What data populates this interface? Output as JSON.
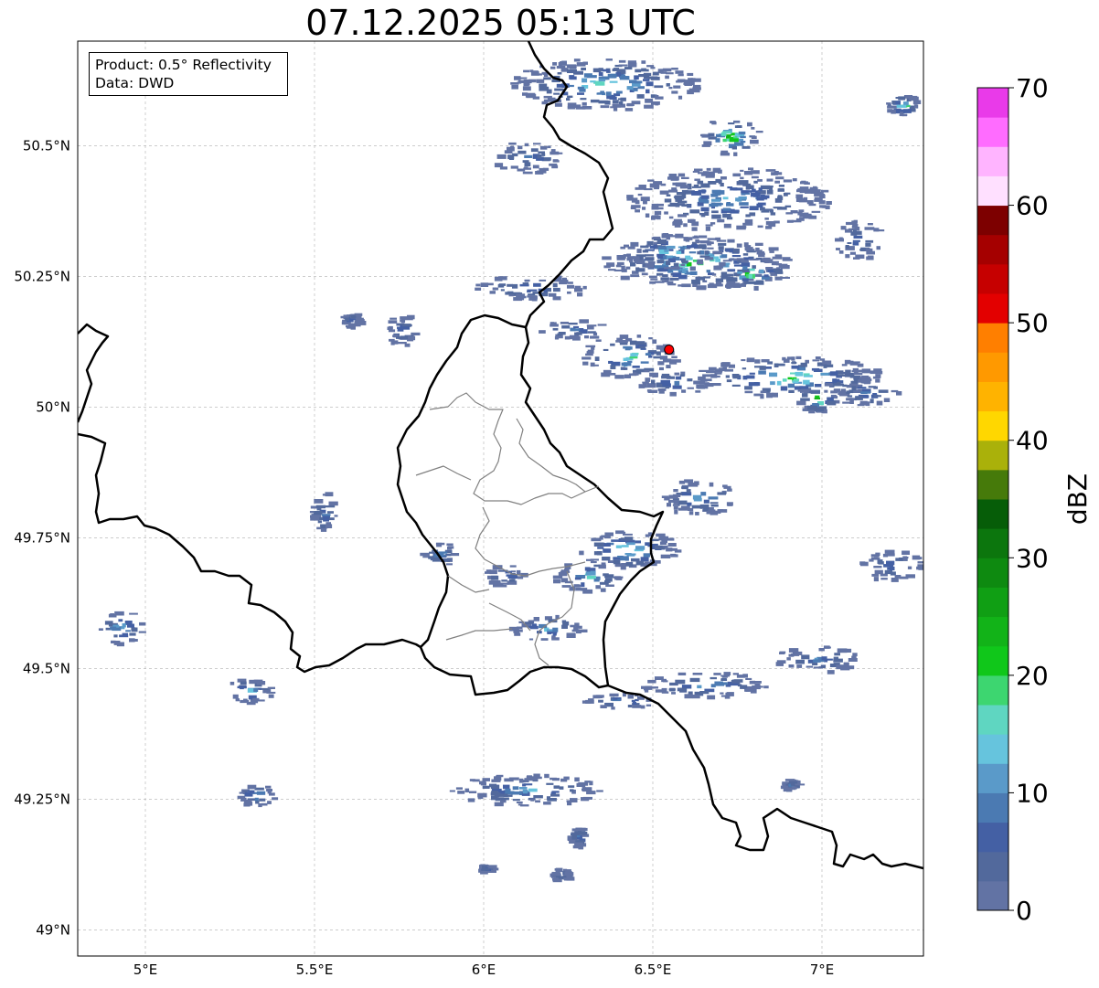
{
  "title": "07.12.2025 05:13 UTC",
  "info": {
    "product": "Product: 0.5° Reflectivity",
    "data": "Data: DWD"
  },
  "map_extent": {
    "lon": [
      4.8,
      7.3
    ],
    "lat": [
      48.95,
      50.7
    ]
  },
  "axes": {
    "lon_ticks": [
      {
        "value": 5.0,
        "label": "5°E"
      },
      {
        "value": 5.5,
        "label": "5.5°E"
      },
      {
        "value": 6.0,
        "label": "6°E"
      },
      {
        "value": 6.5,
        "label": "6.5°E"
      },
      {
        "value": 7.0,
        "label": "7°E"
      }
    ],
    "lat_ticks": [
      {
        "value": 50.5,
        "label": "50.5°N"
      },
      {
        "value": 50.25,
        "label": "50.25°N"
      },
      {
        "value": 50.0,
        "label": "50°N"
      },
      {
        "value": 49.75,
        "label": "49.75°N"
      },
      {
        "value": 49.5,
        "label": "49.5°N"
      },
      {
        "value": 49.25,
        "label": "49.25°N"
      },
      {
        "value": 49.0,
        "label": "49°N"
      }
    ],
    "gridlines": true
  },
  "radar_site": {
    "lon": 6.548,
    "lat": 50.11,
    "color": "#ff0000"
  },
  "colorbar": {
    "label": "dBZ",
    "min": 0,
    "max": 70,
    "step": 2.5,
    "tick_labels": [
      "0",
      "10",
      "20",
      "30",
      "40",
      "50",
      "60",
      "70"
    ],
    "colors": [
      "#6273a4",
      "#52699c",
      "#4460a4",
      "#4b7ab2",
      "#5a9ac9",
      "#66c4dd",
      "#5fd6c1",
      "#3dd670",
      "#10c71a",
      "#12b318",
      "#109f14",
      "#0e8a10",
      "#0c760d",
      "#065d08",
      "#467a0a",
      "#aab10a",
      "#ffd700",
      "#ffb300",
      "#ff9900",
      "#ff7f00",
      "#e30000",
      "#c60000",
      "#a50000",
      "#7d0000",
      "#ffe0ff",
      "#ffb4ff",
      "#ff6cff",
      "#e93ae9"
    ]
  },
  "echoes": [
    {
      "lon": 6.35,
      "lat": 50.62,
      "w": 0.55,
      "h": 0.1,
      "max": 20
    },
    {
      "lon": 6.72,
      "lat": 50.52,
      "w": 0.18,
      "h": 0.07,
      "max": 28
    },
    {
      "lon": 6.72,
      "lat": 50.4,
      "w": 0.6,
      "h": 0.12,
      "max": 14
    },
    {
      "lon": 6.12,
      "lat": 50.48,
      "w": 0.2,
      "h": 0.06,
      "max": 10
    },
    {
      "lon": 6.62,
      "lat": 50.28,
      "w": 0.55,
      "h": 0.1,
      "max": 24
    },
    {
      "lon": 6.78,
      "lat": 50.26,
      "w": 0.22,
      "h": 0.06,
      "max": 28
    },
    {
      "lon": 6.55,
      "lat": 50.3,
      "w": 0.3,
      "h": 0.07,
      "max": 20
    },
    {
      "lon": 6.9,
      "lat": 50.06,
      "w": 0.55,
      "h": 0.08,
      "max": 24
    },
    {
      "lon": 7.12,
      "lat": 50.03,
      "w": 0.2,
      "h": 0.05,
      "max": 12
    },
    {
      "lon": 6.98,
      "lat": 50.02,
      "w": 0.12,
      "h": 0.06,
      "max": 30
    },
    {
      "lon": 6.42,
      "lat": 50.1,
      "w": 0.28,
      "h": 0.08,
      "max": 22
    },
    {
      "lon": 6.55,
      "lat": 50.05,
      "w": 0.22,
      "h": 0.05,
      "max": 12
    },
    {
      "lon": 6.13,
      "lat": 50.23,
      "w": 0.33,
      "h": 0.05,
      "max": 10
    },
    {
      "lon": 6.25,
      "lat": 50.15,
      "w": 0.2,
      "h": 0.04,
      "max": 12
    },
    {
      "lon": 5.75,
      "lat": 50.15,
      "w": 0.1,
      "h": 0.06,
      "max": 9
    },
    {
      "lon": 5.6,
      "lat": 50.17,
      "w": 0.06,
      "h": 0.03,
      "max": 8
    },
    {
      "lon": 6.63,
      "lat": 49.83,
      "w": 0.22,
      "h": 0.07,
      "max": 16
    },
    {
      "lon": 6.42,
      "lat": 49.73,
      "w": 0.3,
      "h": 0.07,
      "max": 24
    },
    {
      "lon": 6.18,
      "lat": 49.58,
      "w": 0.22,
      "h": 0.05,
      "max": 16
    },
    {
      "lon": 6.3,
      "lat": 49.68,
      "w": 0.2,
      "h": 0.06,
      "max": 18
    },
    {
      "lon": 6.05,
      "lat": 49.68,
      "w": 0.12,
      "h": 0.04,
      "max": 12
    },
    {
      "lon": 5.86,
      "lat": 49.72,
      "w": 0.1,
      "h": 0.05,
      "max": 12
    },
    {
      "lon": 5.52,
      "lat": 49.8,
      "w": 0.08,
      "h": 0.08,
      "max": 10
    },
    {
      "lon": 6.65,
      "lat": 49.47,
      "w": 0.38,
      "h": 0.05,
      "max": 14
    },
    {
      "lon": 6.4,
      "lat": 49.44,
      "w": 0.22,
      "h": 0.03,
      "max": 16
    },
    {
      "lon": 6.12,
      "lat": 49.27,
      "w": 0.45,
      "h": 0.06,
      "max": 14
    },
    {
      "lon": 6.27,
      "lat": 49.18,
      "w": 0.05,
      "h": 0.04,
      "max": 10
    },
    {
      "lon": 6.22,
      "lat": 49.11,
      "w": 0.06,
      "h": 0.03,
      "max": 9
    },
    {
      "lon": 6.0,
      "lat": 49.12,
      "w": 0.04,
      "h": 0.015,
      "max": 9
    },
    {
      "lon": 6.98,
      "lat": 49.52,
      "w": 0.25,
      "h": 0.05,
      "max": 10
    },
    {
      "lon": 7.2,
      "lat": 49.7,
      "w": 0.18,
      "h": 0.06,
      "max": 10
    },
    {
      "lon": 6.9,
      "lat": 49.28,
      "w": 0.05,
      "h": 0.02,
      "max": 12
    },
    {
      "lon": 4.92,
      "lat": 49.58,
      "w": 0.13,
      "h": 0.06,
      "max": 20
    },
    {
      "lon": 5.3,
      "lat": 49.46,
      "w": 0.14,
      "h": 0.05,
      "max": 18
    },
    {
      "lon": 5.32,
      "lat": 49.26,
      "w": 0.12,
      "h": 0.04,
      "max": 18
    },
    {
      "lon": 7.23,
      "lat": 50.58,
      "w": 0.1,
      "h": 0.04,
      "max": 26
    },
    {
      "lon": 7.1,
      "lat": 50.32,
      "w": 0.14,
      "h": 0.08,
      "max": 8
    }
  ]
}
